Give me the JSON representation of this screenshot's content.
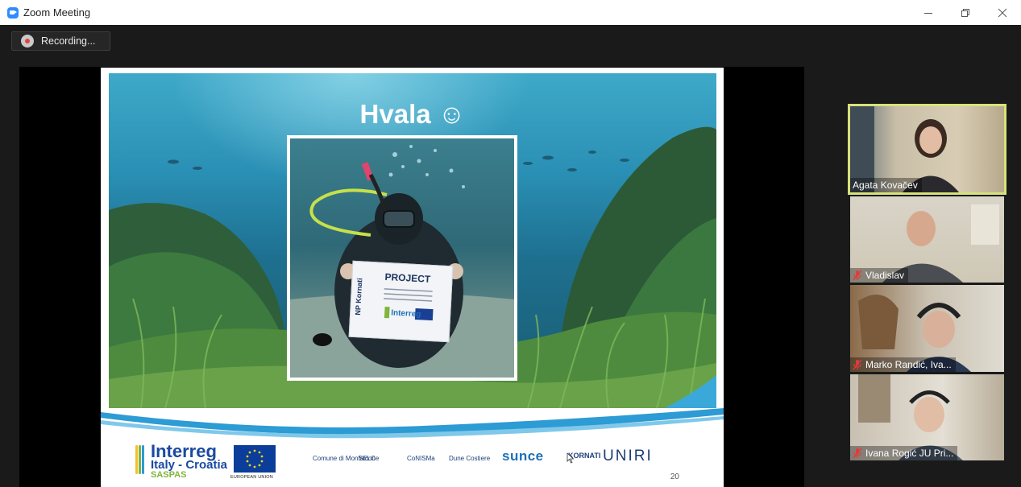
{
  "window": {
    "title": "Zoom Meeting",
    "controls": [
      "minimize",
      "restore",
      "close"
    ]
  },
  "recording": {
    "label": "Recording..."
  },
  "slide": {
    "title": "Hvala ☺",
    "sign": {
      "title": "PROJECT",
      "side_text": "NP Kornati",
      "logo": "Interreg"
    },
    "footer": {
      "program_name": "Interreg",
      "program_region": "Italy - Croatia",
      "project": "SASPAS",
      "eu_label": "EUROPEAN UNION",
      "partners": [
        "Comune di Monfalcone",
        "SELC",
        "CoNISMa",
        "Dune Costiere",
        "sunce",
        "KORNATI",
        "UNIRI"
      ],
      "page_number": "20"
    }
  },
  "participants": [
    {
      "name": "Agata Kovačev",
      "active_speaker": true,
      "muted": false
    },
    {
      "name": "Vladislav",
      "active_speaker": false,
      "muted": true
    },
    {
      "name": "Marko Randić, Iva...",
      "active_speaker": false,
      "muted": true
    },
    {
      "name": "Ivana Rogić JU Pri...",
      "active_speaker": false,
      "muted": true
    }
  ],
  "colors": {
    "active_speaker_border": "#d8e27a",
    "zoom_blue": "#2d8cff",
    "muted_red": "#e23b3b",
    "meeting_bg": "#1a1a1a"
  }
}
